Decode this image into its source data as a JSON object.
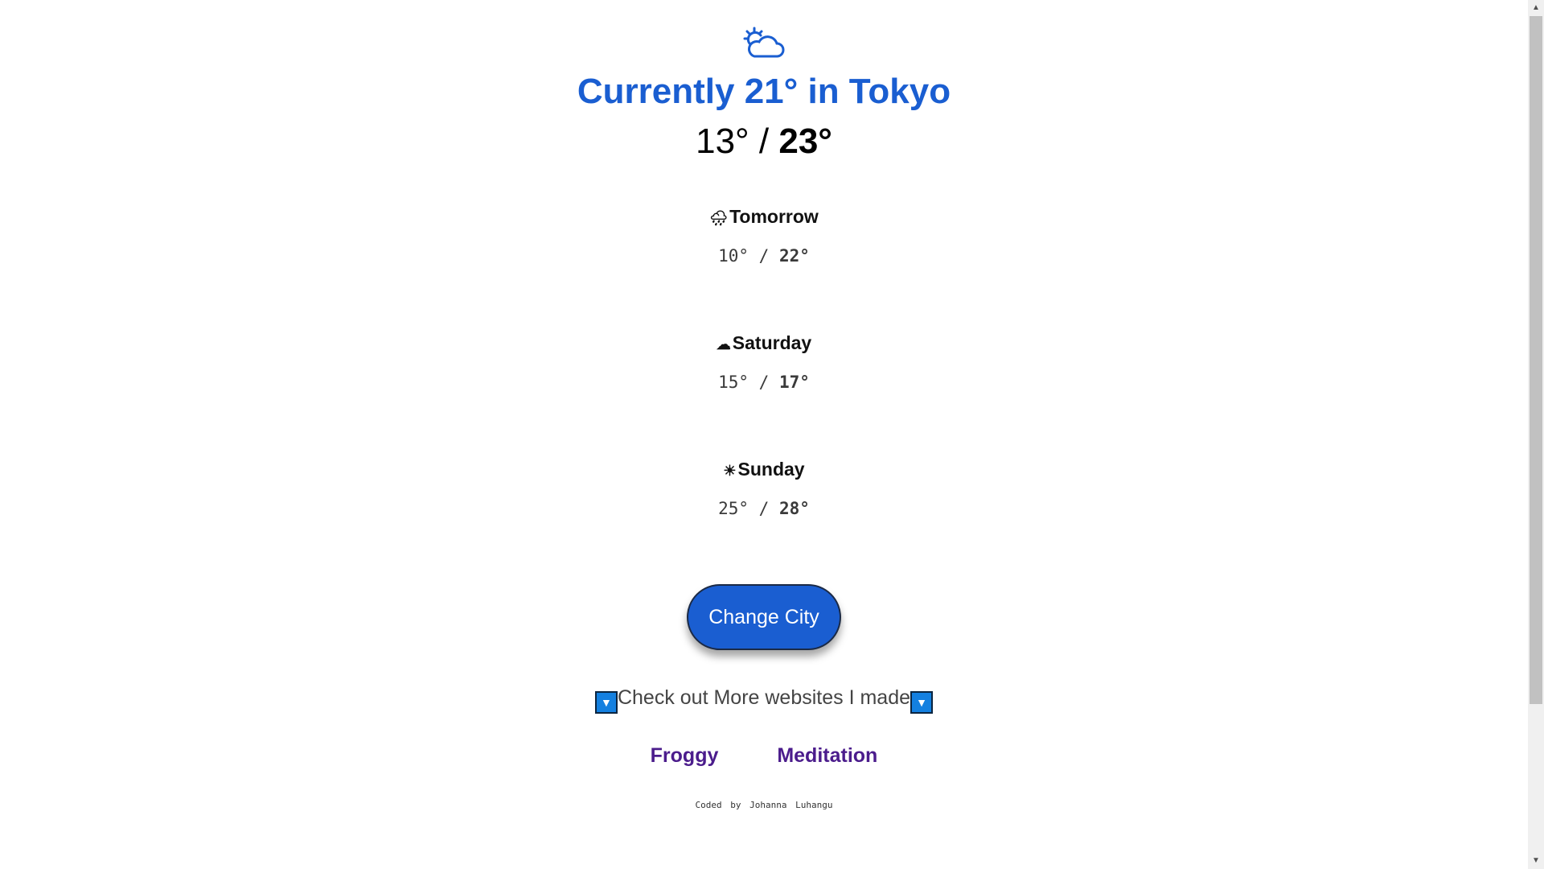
{
  "current": {
    "icon": "cloud-sun-icon",
    "title": "Currently 21° in Tokyo",
    "low": "13°",
    "separator": " / ",
    "high": "23°"
  },
  "forecast": [
    {
      "icon": "rain-cloud-icon",
      "glyph": "🌧",
      "day": "Tomorrow",
      "low": "10°",
      "high": "22°"
    },
    {
      "icon": "cloud-icon",
      "glyph": "☁",
      "day": "Saturday",
      "low": "15°",
      "high": "17°"
    },
    {
      "icon": "sun-icon",
      "glyph": "☀",
      "day": "Sunday",
      "low": "25°",
      "high": "28°"
    }
  ],
  "temp_separator": " / ",
  "change_city_label": "Change City",
  "more": {
    "arrow": "▼",
    "text": "Check out More websites I made"
  },
  "links": [
    "Froggy",
    "Meditation"
  ],
  "credit": "Coded by Johanna Luhangu",
  "colors": {
    "accent": "#1a5ed1",
    "link": "#4b1c8c"
  }
}
